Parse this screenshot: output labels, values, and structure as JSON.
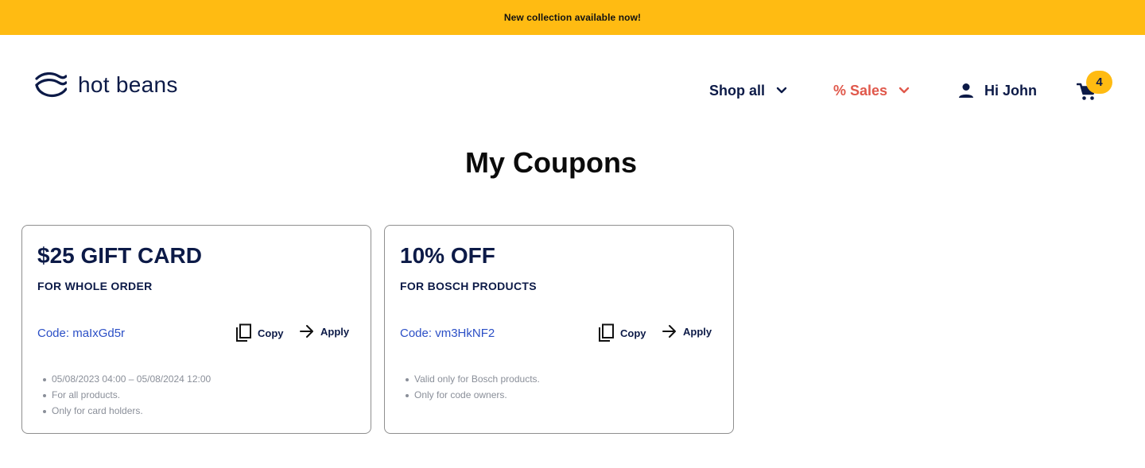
{
  "banner": {
    "text": "New collection available now!"
  },
  "brand": {
    "name": "hot beans",
    "logo_icon": "waves-icon"
  },
  "nav": {
    "shop_all": "Shop all",
    "sales": "% Sales",
    "user_greeting": "Hi John",
    "cart_count": "4"
  },
  "page": {
    "title": "My Coupons"
  },
  "coupons": [
    {
      "title": "$25 GIFT CARD",
      "subtitle": "FOR WHOLE ORDER",
      "code": "Code: maIxGd5r",
      "copy_label": "Copy",
      "apply_label": "Apply",
      "notes": [
        "05/08/2023 04:00 – 05/08/2024 12:00",
        "For all products.",
        "Only for card holders."
      ]
    },
    {
      "title": "10% OFF",
      "subtitle": "FOR BOSCH PRODUCTS",
      "code": "Code: vm3HkNF2",
      "copy_label": "Copy",
      "apply_label": "Apply",
      "notes": [
        "Valid only for Bosch products.",
        "Only for code owners."
      ]
    }
  ],
  "colors": {
    "accent_yellow": "#ffbb12",
    "navy": "#0c1a47",
    "sales_red": "#e0584b",
    "code_blue": "#2b4fc6"
  }
}
